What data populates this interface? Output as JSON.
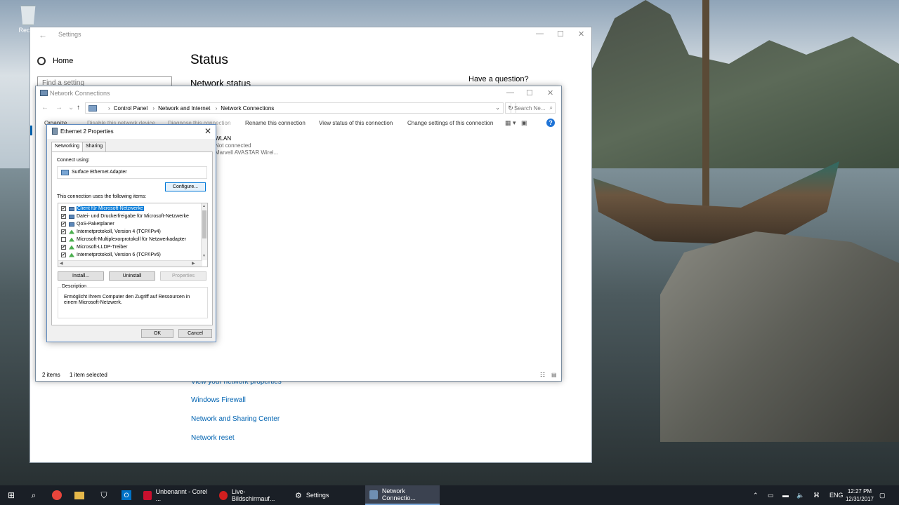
{
  "desktop": {
    "recycle_label": "Recycl"
  },
  "settings": {
    "title": "Settings",
    "home": "Home",
    "find_placeholder": "Find a setting",
    "heading": "Status",
    "subheading": "Network status",
    "have_question": "Have a question?",
    "links": [
      "View your network properties",
      "Windows Firewall",
      "Network and Sharing Center",
      "Network reset"
    ]
  },
  "explorer": {
    "title": "Network Connections",
    "breadcrumb": [
      "Control Panel",
      "Network and Internet",
      "Network Connections"
    ],
    "search_placeholder": "Search Ne...",
    "commands": [
      "Organize",
      "Disable this network device",
      "Diagnose this connection",
      "Rename this connection",
      "View status of this connection",
      "Change settings of this connection"
    ],
    "connection": {
      "name": "WLAN",
      "status": "Not connected",
      "device": "Marvell AVASTAR Wirel..."
    },
    "status_items": "2 items",
    "status_selected": "1 item selected"
  },
  "dialog": {
    "title": "Ethernet 2 Properties",
    "tabs": [
      "Networking",
      "Sharing"
    ],
    "connect_using": "Connect using:",
    "adapter": "Surface Ethernet Adapter",
    "configure": "Configure...",
    "items_label": "This connection uses the following items:",
    "items": [
      {
        "label": "Client für Microsoft-Netzwerke",
        "checked": true,
        "selected": true,
        "icon": "network-client-icon"
      },
      {
        "label": "Datei- und Druckerfreigabe für Microsoft-Netzwerke",
        "checked": true,
        "selected": false,
        "icon": "network-client-icon"
      },
      {
        "label": "QoS-Paketplaner",
        "checked": true,
        "selected": false,
        "icon": "network-client-icon"
      },
      {
        "label": "Internetprotokoll, Version 4 (TCP/IPv4)",
        "checked": true,
        "selected": false,
        "icon": "protocol-icon"
      },
      {
        "label": "Microsoft-Multiplexorprotokoll für Netzwerkadapter",
        "checked": false,
        "selected": false,
        "icon": "protocol-icon"
      },
      {
        "label": "Microsoft-LLDP-Treiber",
        "checked": true,
        "selected": false,
        "icon": "protocol-icon"
      },
      {
        "label": "Internetprotokoll, Version 6 (TCP/IPv6)",
        "checked": true,
        "selected": false,
        "icon": "protocol-icon"
      }
    ],
    "install": "Install...",
    "uninstall": "Uninstall",
    "properties": "Properties",
    "description_label": "Description",
    "description": "Ermöglicht Ihrem Computer den Zugriff auf Ressourcen in einem Microsoft-Netzwerk.",
    "ok": "OK",
    "cancel": "Cancel"
  },
  "taskbar": {
    "apps": [
      {
        "label": "Unbenannt - Corel ...",
        "color": "#c8102e"
      },
      {
        "label": "Live-Bildschirmauf...",
        "color": "#d01f1f"
      },
      {
        "label": "Settings",
        "color": "#ffffff"
      },
      {
        "label": "Network Connectio...",
        "color": "#6f8fb3"
      }
    ],
    "language": "ENG",
    "time": "12:27 PM",
    "date": "12/31/2017"
  },
  "colors": {
    "accent": "#0078d7",
    "link": "#0063b1",
    "taskbar": "#1a1f26"
  }
}
